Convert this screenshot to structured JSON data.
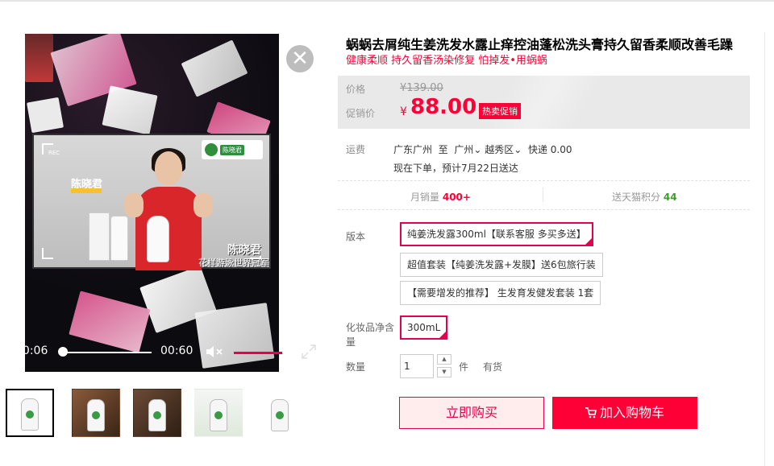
{
  "video": {
    "current_time": "00:06",
    "duration": "00:60",
    "name_tag": "陈晓君",
    "caption_name": "陈晓君",
    "caption_line": "花样游泳世界冠军",
    "rec_label": "REC",
    "logo_name": "陈晓君"
  },
  "product": {
    "title": "蜗蜗去屑纯生姜洗发水露止痒控油蓬松洗头膏持久留香柔顺改善毛躁",
    "subtitle": "健康柔顺 持久留香汤染修复 怕掉发•用蜗蜗"
  },
  "price": {
    "orig_label": "价格",
    "orig_value": "¥139.00",
    "sale_label": "促销价",
    "currency": "¥",
    "sale_value": "88.00",
    "badge": "热卖促销"
  },
  "shipping": {
    "label": "运费",
    "from": "广东广州",
    "to_word": "至",
    "city": "广州",
    "district": "越秀区",
    "express": "快递 0.00",
    "delivery": "现在下单，预计7月22日送达"
  },
  "stats": {
    "sales_label": "月销量",
    "sales_value": "400+",
    "points_label": "送天猫积分",
    "points_value": "44"
  },
  "options": {
    "version_label": "版本",
    "versions": [
      "纯姜洗发露300ml【联系客服 多买多送】",
      "超值套装【纯姜洗发露+发膜】送6包旅行装",
      "【需要增发的推荐】 生发育发健发套装 1套"
    ],
    "size_label": "化妆品净含量",
    "size_value": "300mL"
  },
  "quantity": {
    "label": "数量",
    "value": "1",
    "unit": "件",
    "stock": "有货"
  },
  "actions": {
    "buy_now": "立即购买",
    "add_cart": "加入购物车"
  },
  "colors": {
    "accent": "#ff0036",
    "selected_border": "#e4004f",
    "green": "#3e9c2e"
  }
}
